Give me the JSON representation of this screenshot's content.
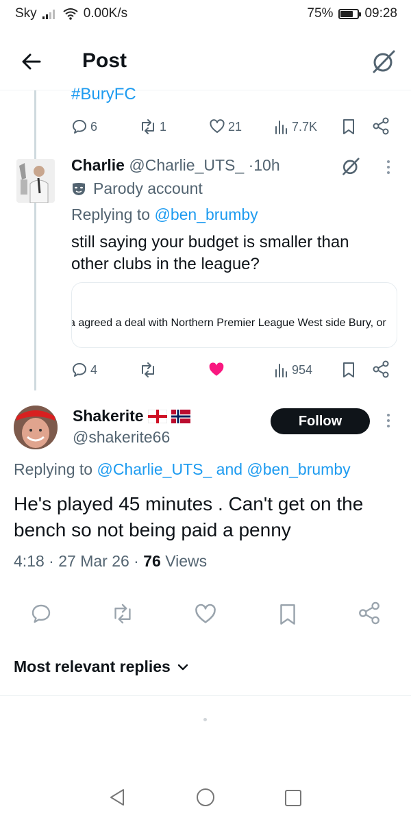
{
  "status_bar": {
    "carrier": "Sky",
    "speed": "0.00K/s",
    "battery": "75%",
    "battery_level": 0.75,
    "time": "09:28"
  },
  "header": {
    "title": "Post"
  },
  "prev_tweet": {
    "hashtag": "#BuryFC",
    "replies": "6",
    "reposts": "1",
    "likes": "21",
    "views": "7.7K"
  },
  "reply_tweet": {
    "name": "Charlie",
    "handle": "@Charlie_UTS_",
    "dot": "·",
    "time": "10h",
    "parody_label": "Parody account",
    "replying_prefix": "Replying to",
    "replying_to": "@ben_brumby",
    "text_line1": "still saying your budget is smaller than",
    "text_line2": "other clubs in the league?",
    "link_preview_text": "a agreed a deal with Northern Premier League West side Bury, or",
    "replies": "4",
    "views": "954",
    "liked_color": "#f91880"
  },
  "main_tweet": {
    "name": "Shakerite",
    "handle": "@shakerite66",
    "follow_label": "Follow",
    "replying_prefix": "Replying to",
    "replying_user1": "@Charlie_UTS_",
    "replying_and": "and",
    "replying_user2": "@ben_brumby",
    "text_line1": "He's played 45 minutes . Can't get on the",
    "text_line2": "bench so not being paid a penny",
    "time": "4:18",
    "date": "27 Mar 26",
    "dot": "·",
    "views_count": "76",
    "views_label": "Views"
  },
  "replies_section": {
    "sort_label": "Most relevant replies"
  },
  "colors": {
    "accent": "#1d9bf0",
    "text": "#0f1419",
    "muted": "#536471",
    "like": "#f91880"
  }
}
